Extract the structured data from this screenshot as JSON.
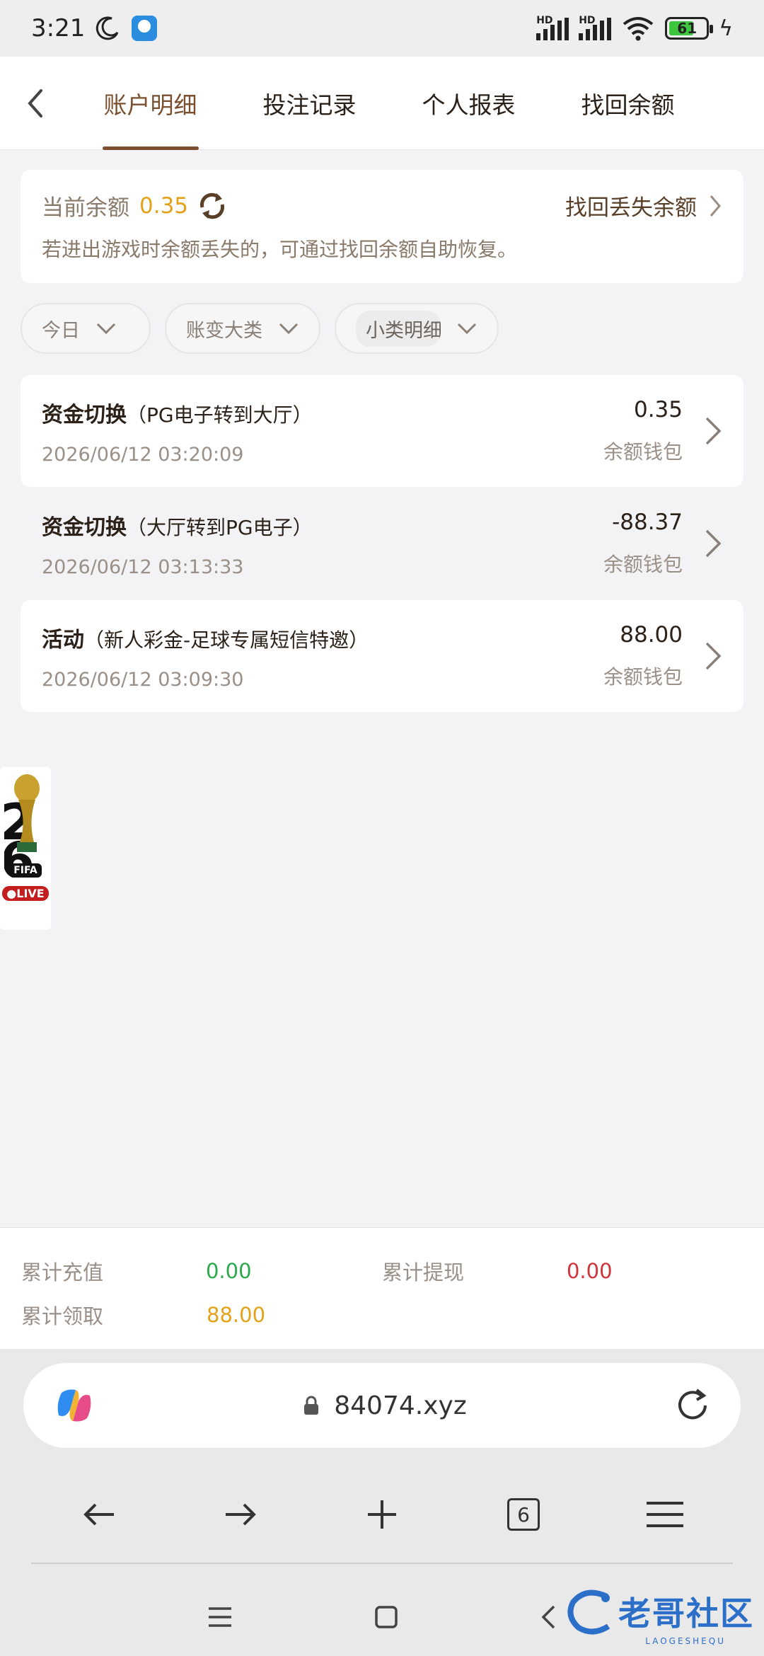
{
  "status_bar": {
    "time": "3:21",
    "battery": "61",
    "network": [
      "HD",
      "HD"
    ]
  },
  "tabs": [
    {
      "label": "账户明细",
      "active": true
    },
    {
      "label": "投注记录",
      "active": false
    },
    {
      "label": "个人报表",
      "active": false
    },
    {
      "label": "找回余额",
      "active": false
    }
  ],
  "balance": {
    "label": "当前余额",
    "value": "0.35",
    "recover_link": "找回丢失余额",
    "hint": "若进出游戏时余额丢失的，可通过找回余额自助恢复。"
  },
  "filters": {
    "date": "今日",
    "category": "账变大类",
    "subcategory": "小类明细"
  },
  "records": [
    {
      "type": "资金切换",
      "detail": "（PG电子转到大厅）",
      "date": "2026/06/12 03:20:09",
      "amount": "0.35",
      "wallet": "余额钱包"
    },
    {
      "type": "资金切换",
      "detail": "（大厅转到PG电子）",
      "date": "2026/06/12 03:13:33",
      "amount": "-88.37",
      "wallet": "余额钱包"
    },
    {
      "type": "活动",
      "detail": "（新人彩金-足球专属短信特邀）",
      "date": "2026/06/12 03:09:30",
      "amount": "88.00",
      "wallet": "余额钱包"
    }
  ],
  "fifa_badge": {
    "label": "FIFA",
    "live": "●LIVE"
  },
  "totals": {
    "deposit_label": "累计充值",
    "deposit_value": "0.00",
    "withdraw_label": "累计提现",
    "withdraw_value": "0.00",
    "claim_label": "累计领取",
    "claim_value": "88.00"
  },
  "browser": {
    "url": "84074.xyz",
    "tab_count": "6"
  },
  "watermark": {
    "text": "老哥社区",
    "sub": "LAOGESHEQU"
  },
  "colors": {
    "accent": "#7a5030",
    "gold": "#e3a21a",
    "green": "#2aa84a",
    "red": "#d0343a"
  }
}
